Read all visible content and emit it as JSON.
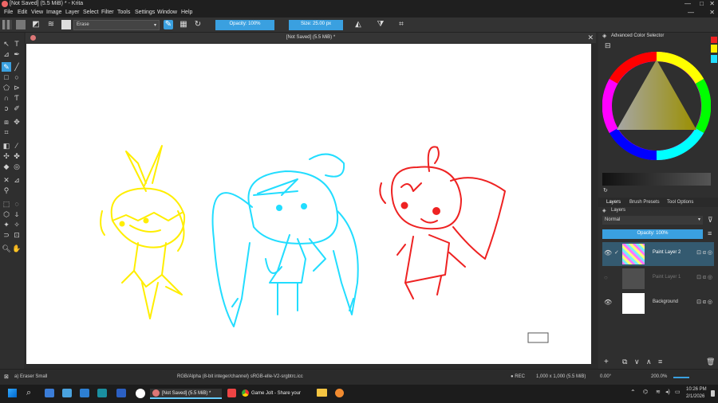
{
  "window": {
    "title": "[Not Saved]  (5.5 MiB) * - Krita"
  },
  "menu": [
    "File",
    "Edit",
    "View",
    "Image",
    "Layer",
    "Select",
    "Filter",
    "Tools",
    "Settings",
    "Window",
    "Help"
  ],
  "toolbar": {
    "brush_preset": "Erase",
    "opacity": "Opacity: 100%",
    "size": "Size: 25.00 px"
  },
  "document": {
    "tab_title": "[Not Saved]  (5.5 MiB) *"
  },
  "panels": {
    "color_selector_title": "Advanced Color Selector",
    "tabs": [
      "Layers",
      "Brush Presets",
      "Tool Options"
    ],
    "layers_title": "Layers",
    "blend_mode": "Normal",
    "layer_opacity": "Opacity:  100%",
    "layers": [
      {
        "name": "Paint Layer 2",
        "selected": true
      },
      {
        "name": "Paint Layer 1",
        "selected": false
      },
      {
        "name": "Background",
        "selected": false
      }
    ]
  },
  "status": {
    "brush": "a) Eraser Small",
    "color_space": "RGB/Alpha (8-bit integer/channel)  sRGB-elle-V2-srgbtrc.icc",
    "rec": "REC",
    "dimensions": "1,000 x 1,000 (5.5 MiB)",
    "rotation": "0.00°",
    "zoom": "200.0%"
  },
  "taskbar": {
    "apps": [
      "[Not Saved]  (5.5 MiB) *",
      "Game Jolt - Share your"
    ],
    "time": "10:26 PM",
    "date": "2/1/2026"
  },
  "colors": {
    "accent": "#3aa0e0",
    "yellow": "#ffee00",
    "cyan": "#22ddff",
    "red": "#ee2222"
  }
}
